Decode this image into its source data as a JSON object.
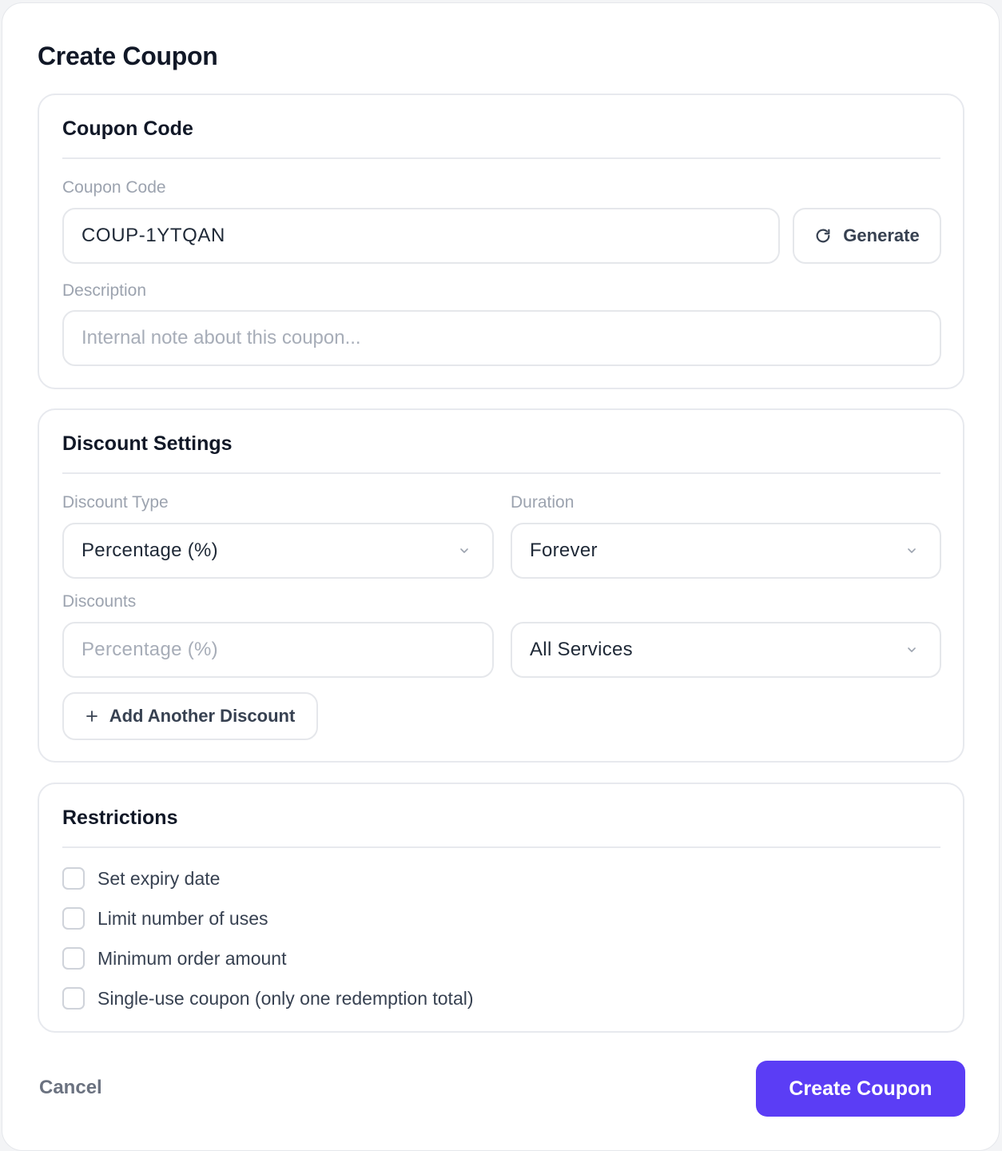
{
  "modal": {
    "title": "Create Coupon"
  },
  "coupon_section": {
    "title": "Coupon Code",
    "code_label": "Coupon Code",
    "code_value": "COUP-1YTQAN",
    "generate_label": "Generate",
    "description_label": "Description",
    "description_placeholder": "Internal note about this coupon..."
  },
  "discount_section": {
    "title": "Discount Settings",
    "type_label": "Discount Type",
    "type_value": "Percentage (%)",
    "duration_label": "Duration",
    "duration_value": "Forever",
    "discounts_label": "Discounts",
    "amount_placeholder": "Percentage (%)",
    "scope_value": "All Services",
    "add_label": "Add Another Discount"
  },
  "restrictions": {
    "title": "Restrictions",
    "items": [
      {
        "label": "Set expiry date",
        "checked": false
      },
      {
        "label": "Limit number of uses",
        "checked": false
      },
      {
        "label": "Minimum order amount",
        "checked": false
      },
      {
        "label": "Single-use coupon (only one redemption total)",
        "checked": false
      }
    ]
  },
  "footer": {
    "cancel_label": "Cancel",
    "submit_label": "Create Coupon"
  },
  "colors": {
    "accent": "#5b3df5",
    "border": "#e5e7eb",
    "muted": "#9ca3af"
  },
  "icons": {
    "generate": "refresh-icon",
    "dropdown": "chevron-down-icon",
    "add": "plus-icon"
  }
}
